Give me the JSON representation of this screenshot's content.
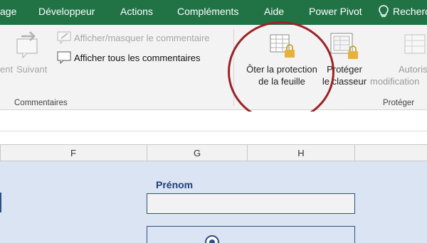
{
  "tabs": {
    "age": "age",
    "developpeur": "Développeur",
    "actions": "Actions",
    "complements": "Compléments",
    "aide": "Aide",
    "power_pivot": "Power Pivot",
    "search": "Recherc"
  },
  "ribbon": {
    "precedent_partial": "ent",
    "suivant": "Suivant",
    "afficher_masquer": "Afficher/masquer le commentaire",
    "afficher_tous": "Afficher tous les commentaires",
    "oter_line1": "Ôter la protection",
    "oter_line2": "de la feuille",
    "proteger_line1": "Protéger",
    "proteger_line2": "le classeur",
    "autoriser_line1": "Autoris",
    "autoriser_line2": "modification",
    "group_commentaires": "Commentaires",
    "group_proteger": "Protéger"
  },
  "columns": [
    "F",
    "G",
    "H"
  ],
  "form": {
    "prenom_label": "Prénom"
  },
  "colors": {
    "tab_bar": "#217346",
    "highlight": "#9b2226",
    "sheet_bg": "#dbe4f3",
    "form_accent": "#1f3f7a"
  },
  "icons": [
    "lightbulb-icon",
    "arrow-next-icon",
    "comment-icon",
    "protect-sheet-icon",
    "protect-workbook-icon",
    "lock-icon",
    "radio-icon"
  ]
}
